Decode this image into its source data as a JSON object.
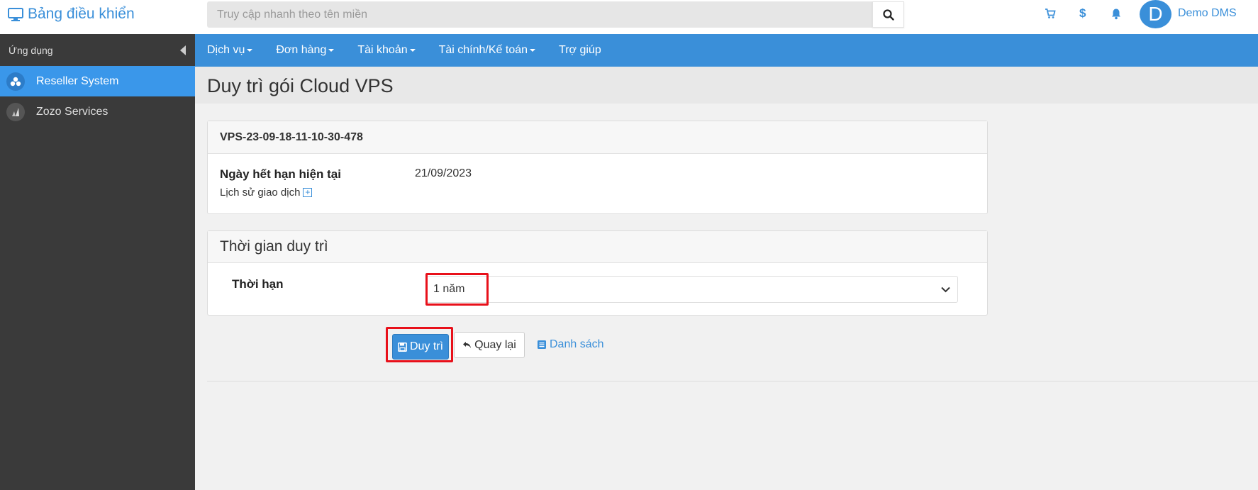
{
  "header": {
    "brand": "Bảng điều khiển",
    "search_placeholder": "Truy cập nhanh theo tên miền",
    "user_initial": "D",
    "username": "Demo DMS",
    "cart_icon": "cart-icon",
    "dollar_label": "$",
    "bell_icon": "bell-icon"
  },
  "sidebar": {
    "title": "Ứng dụng",
    "items": [
      {
        "label": "Reseller System",
        "active": true
      },
      {
        "label": "Zozo Services",
        "active": false
      }
    ]
  },
  "nav": {
    "items": [
      {
        "label": "Dịch vụ",
        "dropdown": true
      },
      {
        "label": "Đơn hàng",
        "dropdown": true
      },
      {
        "label": "Tài khoản",
        "dropdown": true
      },
      {
        "label": "Tài chính/Kế toán",
        "dropdown": true
      },
      {
        "label": "Trợ giúp",
        "dropdown": false
      }
    ]
  },
  "page": {
    "title": "Duy trì gói Cloud VPS"
  },
  "info_panel": {
    "vps_id": "VPS-23-09-18-11-10-30-478",
    "expiry_label": "Ngày hết hạn hiện tại",
    "expiry_value": "21/09/2023",
    "history_label": "Lịch sử giao dịch"
  },
  "renew_panel": {
    "title": "Thời gian duy trì",
    "term_label": "Thời hạn",
    "term_value": "1 năm"
  },
  "actions": {
    "save_label": "Duy trì",
    "back_label": "Quay lại",
    "list_label": "Danh sách"
  },
  "colors": {
    "primary": "#3a8fd9",
    "sidebar_bg": "#3a3a3a",
    "highlight": "#e8101a"
  }
}
